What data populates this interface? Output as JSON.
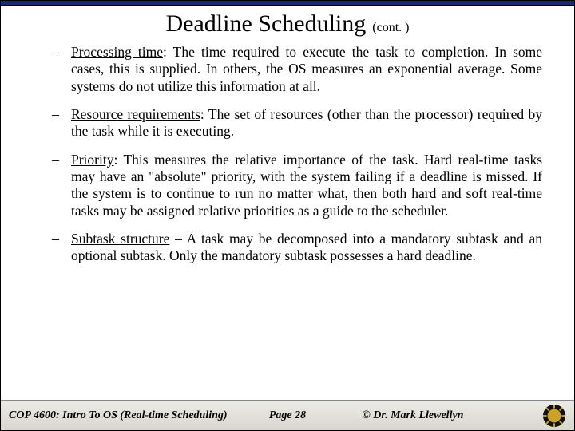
{
  "title": "Deadline Scheduling",
  "title_suffix": "(cont. )",
  "bullets": [
    {
      "term": "Processing time",
      "sep": ":   ",
      "text": "The time required to execute the task to completion.  In some cases, this is supplied.  In others, the OS measures an exponential average.  Some systems do not utilize this information at all."
    },
    {
      "term": "Resource requirements",
      "sep": ":   ",
      "text": "The set of resources (other than the processor) required by the task while it is executing."
    },
    {
      "term": "Priority",
      "sep": ":  ",
      "text": "This measures the relative importance of the task.  Hard real-time tasks may have an \"absolute\" priority, with the system failing if a deadline is missed.  If the system is to continue to run no matter what, then  both hard and soft real-time tasks may be assigned relative priorities as a guide to the scheduler."
    },
    {
      "term": "Subtask structure",
      "sep": " – ",
      "text": "A task may be decomposed into a mandatory subtask and an optional subtask.  Only the mandatory subtask possesses a hard deadline."
    }
  ],
  "footer": {
    "course": "COP 4600: Intro To OS  (Real-time Scheduling)",
    "page": "Page 28",
    "copyright": "© Dr. Mark Llewellyn"
  }
}
